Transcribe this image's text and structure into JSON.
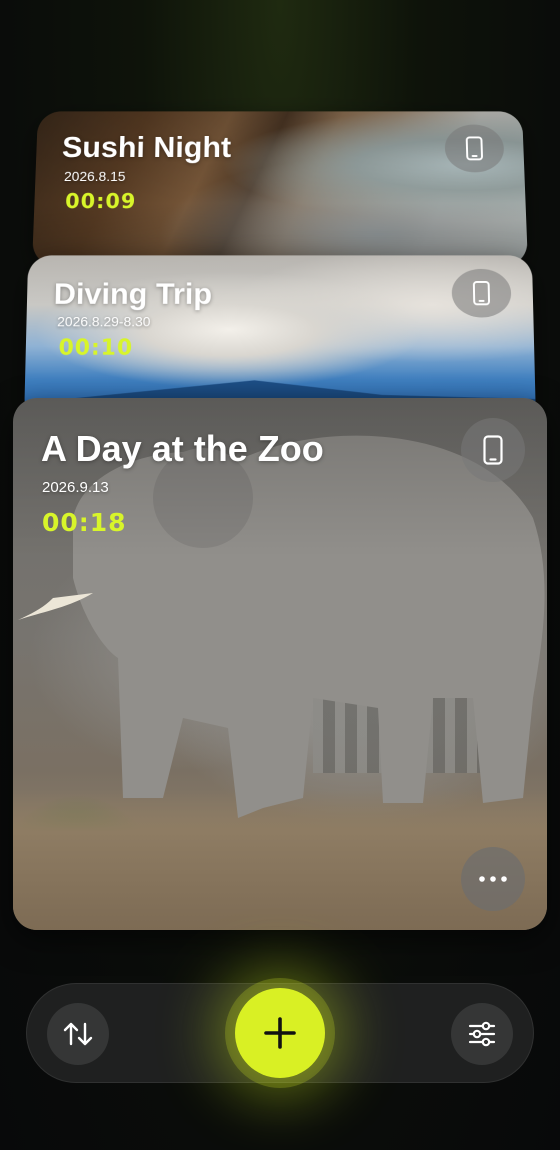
{
  "cards": [
    {
      "title": "Sushi Night",
      "date": "2026.8.15",
      "duration": "00:09",
      "device_icon": "phone-icon"
    },
    {
      "title": "Diving Trip",
      "date": "2026.8.29-8.30",
      "duration": "00:10",
      "device_icon": "phone-icon"
    },
    {
      "title": "A Day at the Zoo",
      "date": "2026.9.13",
      "duration": "00:18",
      "device_icon": "phone-icon",
      "more_icon": "ellipsis-icon"
    }
  ],
  "bottom_bar": {
    "sort_icon": "sort-arrows-icon",
    "add_icon": "plus-icon",
    "filter_icon": "sliders-icon"
  },
  "colors": {
    "accent": "#d9f024",
    "duration_text": "#d8f52a",
    "bar_background": "#1f2020"
  }
}
